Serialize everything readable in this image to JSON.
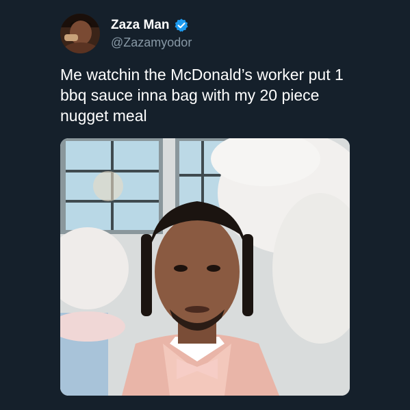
{
  "tweet": {
    "author": {
      "display_name": "Zaza Man",
      "handle": "@Zazamyodor",
      "verified": true,
      "verified_icon": "verified-badge-icon",
      "verified_color": "#1d9bf0"
    },
    "text": "Me watchin the McDonald’s worker put 1 bbq sauce inna bag with my 20 piece nugget meal",
    "media": {
      "type": "photo",
      "icon": "photo-image"
    }
  },
  "theme": {
    "background": "#15202b",
    "primary_text": "#ffffff",
    "secondary_text": "#8899a6"
  }
}
